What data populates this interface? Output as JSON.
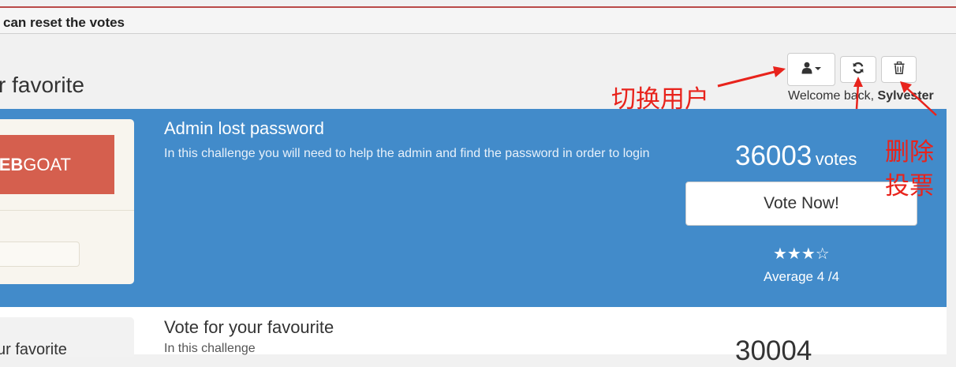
{
  "banner": {
    "text": "can reset the votes"
  },
  "page": {
    "title": "r favorite"
  },
  "toolbar": {
    "user_button_icon": "user-icon",
    "refresh_button_icon": "refresh-icon",
    "delete_button_icon": "trash-icon"
  },
  "welcome": {
    "prefix": "Welcome back, ",
    "username": "Sylvester"
  },
  "challenges": [
    {
      "logo_bold": "EB",
      "logo_text": "GOAT",
      "title": "Admin lost password",
      "description": "In this challenge you will need to help the admin and find the password in order to login",
      "votes": "36003",
      "votes_label": "votes",
      "vote_button": "Vote Now!",
      "stars": "★★★☆",
      "rating_stars": 3,
      "rating_max": 4,
      "average": "Average 4 /4"
    },
    {
      "thumb_text": "ur favorite",
      "title": "Vote for your favourite",
      "description": "In this challenge",
      "votes": "30004"
    }
  ],
  "annotations": {
    "switch_user": "切换用户",
    "delete_votes_line1": "删除",
    "delete_votes_line2": "投票"
  },
  "colors": {
    "active_card": "#428bca",
    "logo": "#d55f4e",
    "annotation": "#e8231c",
    "banner_border": "#b94a48"
  }
}
